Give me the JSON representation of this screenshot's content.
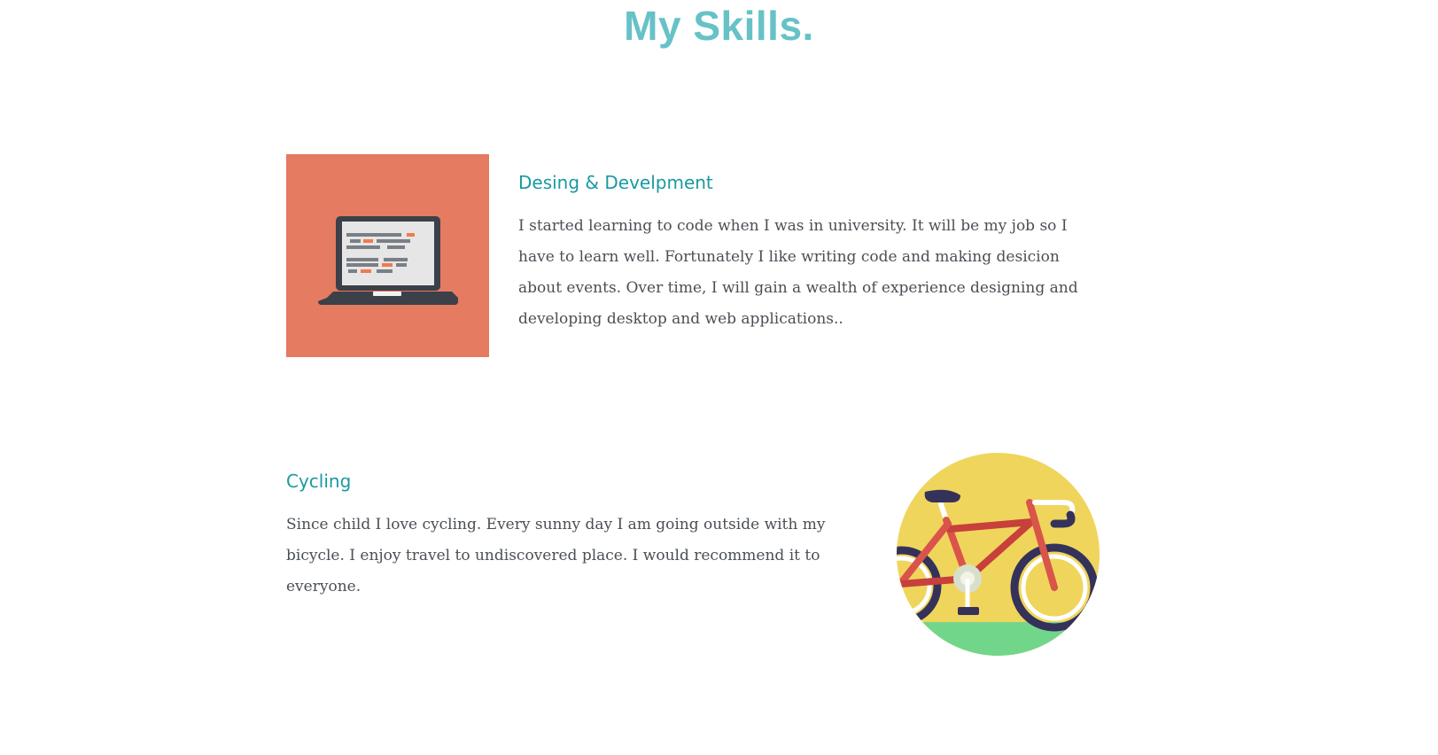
{
  "page": {
    "title": "My Skills."
  },
  "skills": [
    {
      "heading": "Desing & Develpment",
      "text": "I started learning to code when I was in university. It will be my job so I have to learn well. Fortunately I like writing code and making desicion about events. Over time, I will gain a wealth of experience designing and developing desktop and web applications..",
      "icon": "laptop-icon"
    },
    {
      "heading": "Cycling",
      "text": "Since child I love cycling. Every sunny day I am going outside with my bicycle. I enjoy travel to undiscovered place. I would recommend it to everyone.",
      "icon": "bicycle-icon"
    }
  ],
  "colors": {
    "title": "#66c2c6",
    "heading": "#1a9aa0",
    "body_text": "#4a4f55",
    "dev_tile": "#e57b61",
    "cycling_circle": "#f0d55c",
    "grass": "#72d68a"
  }
}
